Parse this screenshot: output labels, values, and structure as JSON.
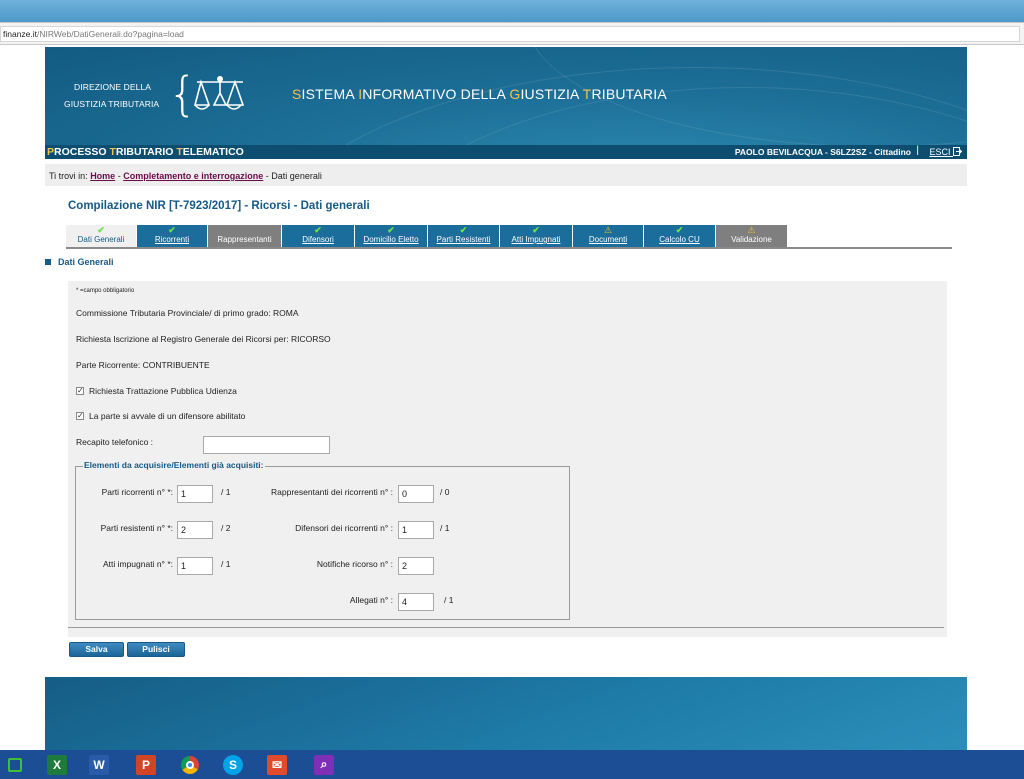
{
  "browser": {
    "url_host": "finanze.it",
    "url_path": "/NIRWeb/DatiGenerali.do?pagina=load"
  },
  "header": {
    "dir_line1": "DIREZIONE DELLA",
    "dir_line2": "GIUSTIZIA TRIBUTARIA",
    "sys_title_parts": [
      "S",
      "ISTEMA ",
      "I",
      "NFORMATIVO DELLA ",
      "G",
      "IUSTIZIA ",
      "T",
      "RIBUTARIA"
    ],
    "pt_parts": [
      "P",
      "ROCESSO ",
      "T",
      "RIBUTARIO ",
      "T",
      "ELEMATICO"
    ],
    "user": "PAOLO BEVILACQUA - S6LZ2SZ - Cittadino",
    "separator": "|",
    "logout": "ESCI"
  },
  "breadcrumb": {
    "prefix": "Ti trovi in:",
    "home": "Home",
    "sep1": "-",
    "middle": "Completamento e interrogazione",
    "sep2": "-",
    "current": "Dati generali"
  },
  "page_title": "Compilazione NIR [T-7923/2017] - Ricorsi - Dati generali",
  "tabs": [
    {
      "label": "Dati Generali",
      "mark": "✔",
      "state": "ok"
    },
    {
      "label": "Ricorrenti",
      "mark": "✔",
      "state": "ok"
    },
    {
      "label": "Rappresentanti",
      "mark": "",
      "state": "none"
    },
    {
      "label": "Difensori",
      "mark": "✔",
      "state": "ok"
    },
    {
      "label": "Domicilio Eletto",
      "mark": "✔",
      "state": "ok"
    },
    {
      "label": "Parti Resistenti",
      "mark": "✔",
      "state": "ok"
    },
    {
      "label": "Atti Impugnati",
      "mark": "✔",
      "state": "ok"
    },
    {
      "label": "Documenti",
      "mark": "⚠",
      "state": "warn"
    },
    {
      "label": "Calcolo CU",
      "mark": "✔",
      "state": "ok"
    },
    {
      "label": "Validazione",
      "mark": "⚠",
      "state": "warn"
    }
  ],
  "section_title": "Dati Generali",
  "form": {
    "required_note": "* =campo obbligatorio",
    "commissione": "Commissione Tributaria Provinciale/ di primo grado: ROMA",
    "richiesta": "Richiesta Iscrizione al Registro Generale dei Ricorsi per: RICORSO",
    "parte_ricorrente": "Parte Ricorrente: CONTRIBUENTE",
    "cb_udienza_label": "Richiesta Trattazione Pubblica Udienza",
    "cb_udienza_checked": true,
    "cb_difensore_label": "La parte si avvale di un difensore abilitato",
    "cb_difensore_checked": true,
    "recapito_label": "Recapito telefonico   :",
    "recapito_value": "",
    "legend": "Elementi da acquisire/Elementi già acquisiti:",
    "fields": {
      "parti_ricorrenti": {
        "label": "Parti ricorrenti n° *:",
        "value": "1",
        "total": "/ 1"
      },
      "rappresentanti": {
        "label": "Rappresentanti dei ricorrenti n° :",
        "value": "0",
        "total": "/ 0"
      },
      "parti_resistenti": {
        "label": "Parti resistenti n° *:",
        "value": "2",
        "total": "/ 2"
      },
      "difensori": {
        "label": "Difensori dei ricorrenti n° :",
        "value": "1",
        "total": "/ 1"
      },
      "atti_impugnati": {
        "label": "Atti impugnati n° *:",
        "value": "1",
        "total": "/ 1"
      },
      "notifiche": {
        "label": "Notifiche ricorso n° :",
        "value": "2",
        "total": ""
      },
      "allegati": {
        "label": "Allegati n° :",
        "value": "4",
        "total": "/ 1"
      }
    }
  },
  "buttons": {
    "save": "Salva",
    "clear": "Pulisci"
  },
  "taskbar": {
    "icons": [
      "store-icon",
      "excel-icon",
      "word-icon",
      "powerpoint-icon",
      "chrome-icon",
      "skype-icon",
      "mail-icon",
      "search-app-icon"
    ],
    "colors": {
      "bar": "#1c4e95",
      "accent": "#165a86"
    }
  }
}
